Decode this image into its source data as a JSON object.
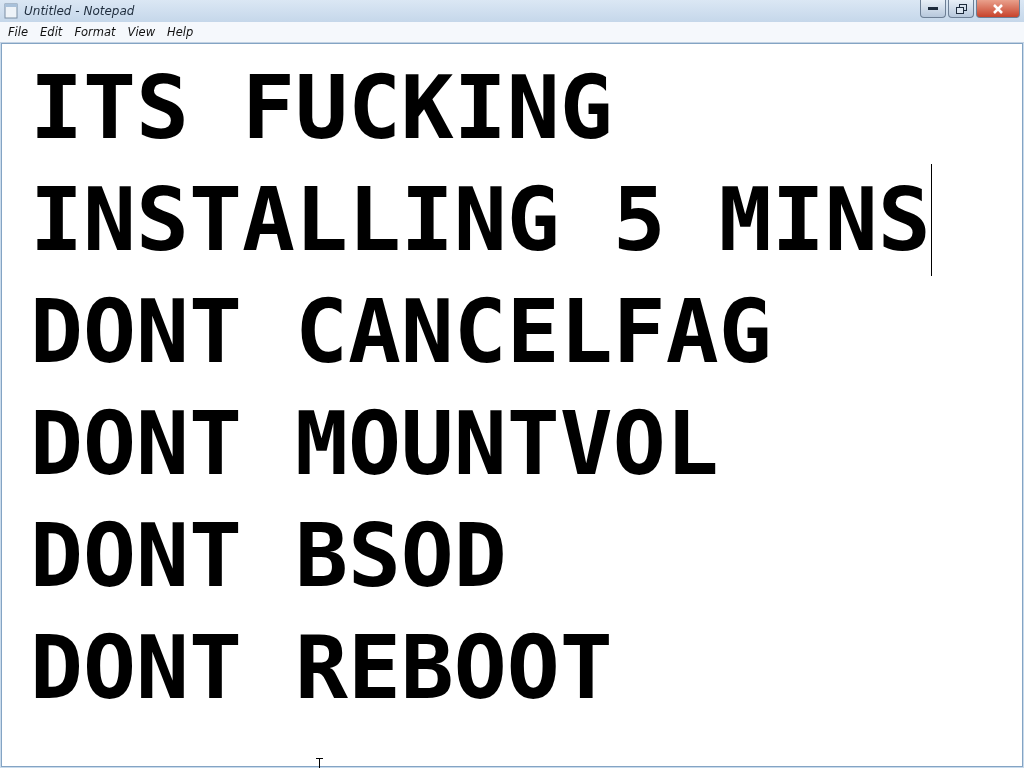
{
  "window": {
    "title": "Untitled - Notepad"
  },
  "menu": [
    "File",
    "Edit",
    "Format",
    "View",
    "Help"
  ],
  "document": {
    "lines": [
      {
        "text": "ITS FUCKING",
        "caret": false
      },
      {
        "text": "INSTALLING 5 MINS",
        "caret": true
      },
      {
        "text": "DONT CANCELFAG",
        "caret": false
      },
      {
        "text": "DONT MOUNTVOL",
        "caret": false
      },
      {
        "text": "DONT BSOD",
        "caret": false
      },
      {
        "text": "DONT REBOOT",
        "caret": false
      }
    ]
  }
}
